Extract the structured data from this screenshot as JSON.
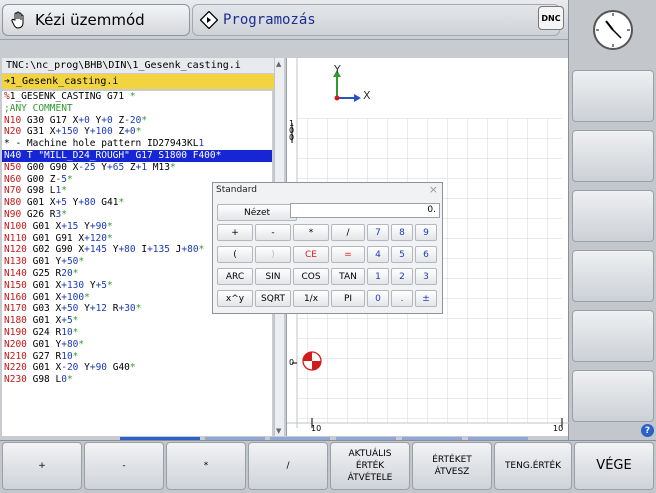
{
  "header": {
    "manual_tab": "Kézi üzemmód",
    "program_tab": "Programozás",
    "dnc_label": "DNC"
  },
  "program": {
    "path": "TNC:\\nc_prog\\BHB\\DIN\\1_Gesenk_casting.i",
    "file": "➔1_Gesenk_casting.i",
    "lines": [
      "%1_GESENK_CASTING G71 *",
      ";ANY COMMENT",
      "N10 G30 G17 X+0 Y+0 Z-20*",
      "N20 G31 X+150 Y+100 Z+0*",
      "* - Machine hole pattern ID27943KL1",
      "N40 T \"MILL_D24_ROUGH\" G17 S1800 F400*",
      "N50 G00 G90 X-25 Y+65 Z+1 M13*",
      "N60 G00 Z-5*",
      "N70 G98 L1*",
      "N80 G01 X+5 Y+80 G41*",
      "N90 G26 R3*",
      "N100 G01 X+15 Y+90*",
      "N110 G01 G91 X+120*",
      "N120 G02 G90 X+145 Y+80 I+135 J+80*",
      "N130 G01 Y+50*",
      "N140 G25 R20*",
      "N150 G01 X+130 Y+5*",
      "N160 G01 X+100*",
      "N170 G03 X+50 Y+12 R+30*",
      "N180 G01 X+5*",
      "N190 G24 R10*",
      "N200 G01 Y+80*",
      "N210 G27 R10*",
      "N220 G01 X-20 Y+90 G40*",
      "N230 G98 L0*"
    ],
    "selected_line": 5
  },
  "graphic": {
    "axis_x": "X",
    "axis_y": "Y",
    "ruler_top": [
      "0",
      "10"
    ],
    "ruler_left": [
      "0",
      "1",
      "0",
      "0"
    ],
    "ruler_bottom_start": "0",
    "ruler_bottom_end": "10",
    "origin_label": "0"
  },
  "calculator": {
    "title": "Standard",
    "close": "×",
    "view_button": "Nézet",
    "display": "0.",
    "keys": [
      [
        "+",
        "-",
        "*",
        "/",
        "7",
        "8",
        "9"
      ],
      [
        "(",
        ")",
        "CE",
        "=",
        "4",
        "5",
        "6"
      ],
      [
        "ARC",
        "SIN",
        "COS",
        "TAN",
        "1",
        "2",
        "3"
      ],
      [
        "x^y",
        "SQRT",
        "1/x",
        "PI",
        "0",
        ".",
        "±"
      ]
    ]
  },
  "softkeys": {
    "bottom": [
      "+",
      "-",
      "*",
      "/",
      "AKTUÁLIS\nÉRTÉK\nÁTVÉTELE",
      "ÉRTÉKET\nÁTVESZ",
      "TENG.ÉRTÉK",
      "VÉGE"
    ],
    "help_icon": "?"
  },
  "colors": {
    "selection": "#1726d4",
    "filename_bar": "#f2d441",
    "keyword_red": "#c41818",
    "number_blue": "#1d3ab8",
    "comment_green": "#2f9a2f"
  }
}
